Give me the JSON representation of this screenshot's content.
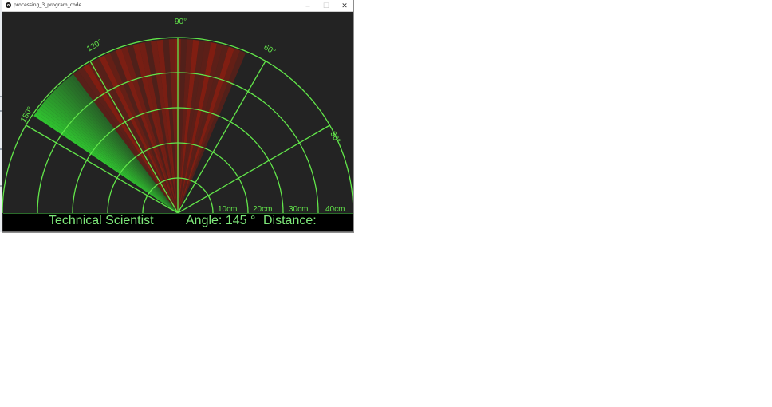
{
  "window": {
    "title": "processing_3_program_code",
    "minimize_glyph": "–",
    "maximize_glyph": "☐",
    "close_glyph": "✕",
    "app_icon": "processing-app-icon"
  },
  "radar": {
    "angle_labels": [
      "30°",
      "60°",
      "90°",
      "120°",
      "150°"
    ],
    "distance_labels": [
      "10cm",
      "20cm",
      "30cm",
      "40cm"
    ],
    "grid_color": "#62e64a",
    "sweep_color": "#32d932",
    "object_color": "#a01c0c",
    "background": "#232323"
  },
  "status": {
    "brand": "Technical Scientist",
    "angle_text": "Angle: 145 °",
    "distance_text": "Distance:"
  }
}
